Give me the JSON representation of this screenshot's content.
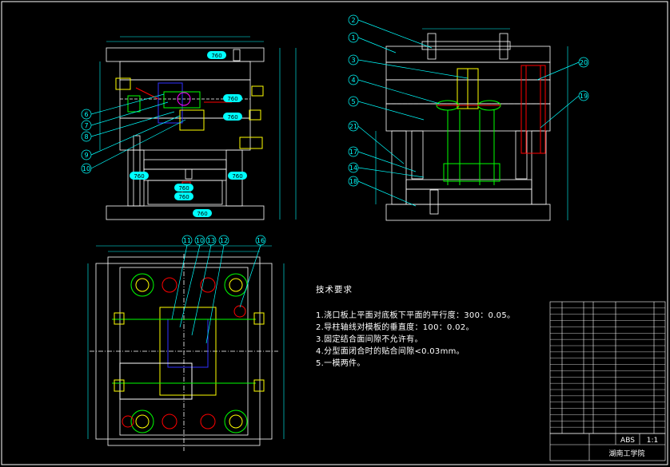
{
  "drawing": {
    "tech_title": "技术要求",
    "requirements": [
      "1.浇口板上平面对底板下平面的平行度：300：0.05。",
      "2.导柱轴线对模板的垂直度：100：0.02。",
      "3.固定结合面间隙不允许有。",
      "4.分型面闭合时的贴合间隙<0.03mm。",
      "5.一模两件。"
    ]
  },
  "front_view_callouts": [
    "6",
    "7",
    "8",
    "9",
    "10"
  ],
  "section_view_callouts_left": [
    "2",
    "1",
    "3",
    "4",
    "5",
    "21",
    "17",
    "14",
    "18"
  ],
  "section_view_callouts_right": [
    "20",
    "19"
  ],
  "plan_view_callouts": [
    "11",
    "10",
    "13",
    "12",
    "16"
  ],
  "front_view_tags": [
    "760",
    "760",
    "760",
    "760",
    "760",
    "760",
    "760",
    "760"
  ],
  "title_block": {
    "material": "ABS",
    "school": "湖南工学院",
    "scale": "1:1"
  },
  "colors": {
    "background": "#000000",
    "outline": "#ffffff",
    "callout": "#00ffff",
    "green": "#00ff00",
    "red": "#ff0000",
    "blue": "#3030ff",
    "yellow": "#ffff00",
    "magenta": "#ff00ff"
  }
}
